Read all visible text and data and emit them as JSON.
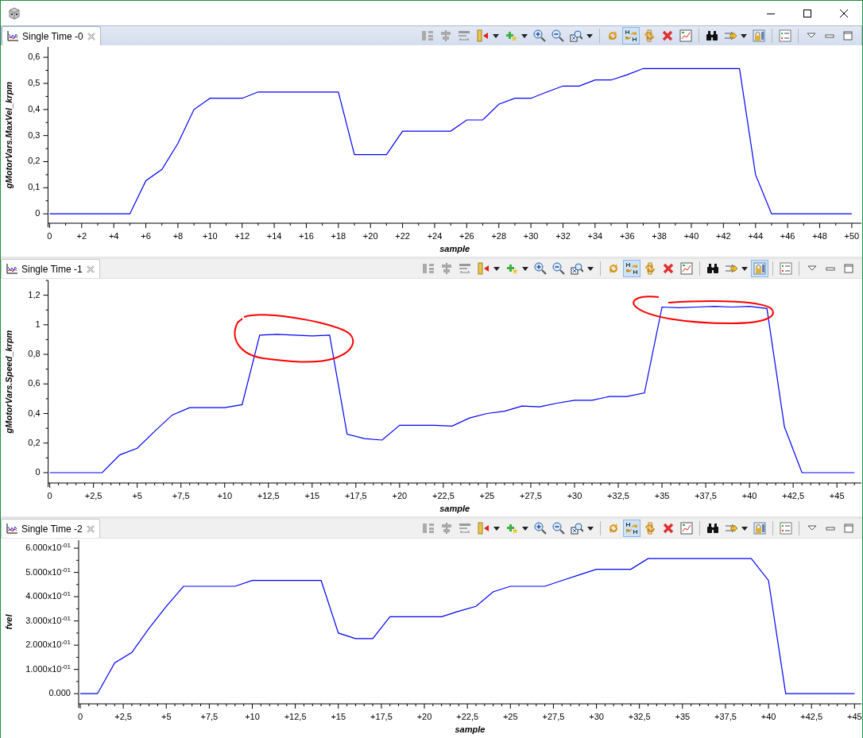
{
  "panels": [
    {
      "tab": {
        "label": "Single Time -0",
        "active": true
      },
      "toolbar": [
        {
          "selected": false
        },
        {
          "selected": false
        },
        {
          "selected": false
        },
        {
          "selected": false
        },
        {
          "selected": false
        },
        {
          "selected": false
        },
        {
          "selected": false
        },
        {
          "selected": false
        },
        {
          "selected": false
        },
        {
          "selected": true
        },
        {
          "selected": false
        },
        {
          "selected": false
        },
        {
          "selected": false
        },
        {
          "selected": false
        },
        {
          "selected": false
        },
        {
          "selected": false
        },
        {
          "selected": false
        }
      ],
      "chart_data": {
        "type": "line",
        "xlabel": "sample",
        "ylabel": "gMotorVars.MaxVel_krpm",
        "xlim": [
          -0.1,
          50.6
        ],
        "ylim": [
          -0.036,
          0.64
        ],
        "x": [
          0,
          1,
          2,
          3,
          4,
          5,
          6,
          7,
          8,
          9,
          10,
          11,
          12,
          13,
          14,
          15,
          16,
          17,
          18,
          19,
          20,
          21,
          22,
          23,
          24,
          25,
          26,
          27,
          28,
          29,
          30,
          31,
          32,
          33,
          34,
          35,
          36,
          37,
          38,
          39,
          40,
          41,
          42,
          43,
          44,
          45,
          46,
          47,
          48,
          49,
          50
        ],
        "series": [
          {
            "color": "#0000ff",
            "values": [
              0,
              0,
              0,
              0,
              0,
              0,
              0.127,
              0.17,
              0.27,
              0.4,
              0.443,
              0.443,
              0.443,
              0.467,
              0.467,
              0.467,
              0.467,
              0.467,
              0.467,
              0.227,
              0.227,
              0.227,
              0.317,
              0.317,
              0.317,
              0.317,
              0.36,
              0.36,
              0.42,
              0.443,
              0.443,
              0.467,
              0.49,
              0.49,
              0.513,
              0.513,
              0.533,
              0.557,
              0.557,
              0.557,
              0.557,
              0.557,
              0.557,
              0.557,
              0.15,
              0,
              0,
              0,
              0,
              0,
              0
            ]
          }
        ],
        "xticks": [
          {
            "value": 0,
            "label": "0"
          },
          {
            "value": 2,
            "label": "+2"
          },
          {
            "value": 4,
            "label": "+4"
          },
          {
            "value": 6,
            "label": "+6"
          },
          {
            "value": 8,
            "label": "+8"
          },
          {
            "value": 10,
            "label": "+10"
          },
          {
            "value": 12,
            "label": "+12"
          },
          {
            "value": 14,
            "label": "+14"
          },
          {
            "value": 16,
            "label": "+16"
          },
          {
            "value": 18,
            "label": "+18"
          },
          {
            "value": 20,
            "label": "+20"
          },
          {
            "value": 22,
            "label": "+22"
          },
          {
            "value": 24,
            "label": "+24"
          },
          {
            "value": 26,
            "label": "+26"
          },
          {
            "value": 28,
            "label": "+28"
          },
          {
            "value": 30,
            "label": "+30"
          },
          {
            "value": 32,
            "label": "+32"
          },
          {
            "value": 34,
            "label": "+34"
          },
          {
            "value": 36,
            "label": "+36"
          },
          {
            "value": 38,
            "label": "+38"
          },
          {
            "value": 40,
            "label": "+40"
          },
          {
            "value": 42,
            "label": "+42"
          },
          {
            "value": 44,
            "label": "+44"
          },
          {
            "value": 46,
            "label": "+46"
          },
          {
            "value": 48,
            "label": "+48"
          },
          {
            "value": 50,
            "label": "+50"
          }
        ],
        "yticks": [
          {
            "value": 0,
            "label": "0"
          },
          {
            "value": 0.1,
            "label": "0,1"
          },
          {
            "value": 0.2,
            "label": "0,2"
          },
          {
            "value": 0.3,
            "label": "0,3"
          },
          {
            "value": 0.4,
            "label": "0,4"
          },
          {
            "value": 0.5,
            "label": "0,5"
          },
          {
            "value": 0.6,
            "label": "0,6"
          }
        ]
      }
    },
    {
      "tab": {
        "label": "Single Time -1",
        "active": false
      },
      "red_marks": true,
      "toolbar": [
        {
          "selected": false
        },
        {
          "selected": false
        },
        {
          "selected": false
        },
        {
          "selected": false
        },
        {
          "selected": false
        },
        {
          "selected": false
        },
        {
          "selected": false
        },
        {
          "selected": false
        },
        {
          "selected": false
        },
        {
          "selected": true
        },
        {
          "selected": false
        },
        {
          "selected": false
        },
        {
          "selected": false
        },
        {
          "selected": false
        },
        {
          "selected": false
        },
        {
          "selected": true
        },
        {
          "selected": false
        }
      ],
      "chart_data": {
        "type": "line",
        "xlabel": "sample",
        "ylabel": "gMotorVars.Speed_krpm",
        "xlim": [
          -0.1,
          46.4
        ],
        "ylim": [
          -0.07,
          1.3
        ],
        "x": [
          0,
          1,
          2,
          3,
          4,
          5,
          6,
          7,
          8,
          9,
          10,
          11,
          12,
          13,
          14,
          15,
          16,
          17,
          18,
          19,
          20,
          21,
          22,
          23,
          24,
          25,
          26,
          27,
          28,
          29,
          30,
          31,
          32,
          33,
          34,
          35,
          36,
          37,
          38,
          39,
          40,
          41,
          42,
          43,
          44,
          45,
          46
        ],
        "series": [
          {
            "color": "#0000ff",
            "values": [
              0,
              0,
              0,
              0,
              0.12,
              0.165,
              0.28,
              0.39,
              0.44,
              0.44,
              0.44,
              0.46,
              0.93,
              0.935,
              0.93,
              0.925,
              0.93,
              0.26,
              0.23,
              0.22,
              0.32,
              0.32,
              0.32,
              0.315,
              0.37,
              0.4,
              0.415,
              0.45,
              0.445,
              0.47,
              0.49,
              0.49,
              0.515,
              0.515,
              0.54,
              1.12,
              1.115,
              1.12,
              1.125,
              1.12,
              1.125,
              1.11,
              0.31,
              0,
              0,
              0,
              0
            ]
          }
        ],
        "xticks": [
          {
            "value": 0,
            "label": "0"
          },
          {
            "value": 2.5,
            "label": "+2,5"
          },
          {
            "value": 5,
            "label": "+5"
          },
          {
            "value": 7.5,
            "label": "+7,5"
          },
          {
            "value": 10,
            "label": "+10"
          },
          {
            "value": 12.5,
            "label": "+12,5"
          },
          {
            "value": 15,
            "label": "+15"
          },
          {
            "value": 17.5,
            "label": "+17,5"
          },
          {
            "value": 20,
            "label": "+20"
          },
          {
            "value": 22.5,
            "label": "+22,5"
          },
          {
            "value": 25,
            "label": "+25"
          },
          {
            "value": 27.5,
            "label": "+27,5"
          },
          {
            "value": 30,
            "label": "+30"
          },
          {
            "value": 32.5,
            "label": "+32,5"
          },
          {
            "value": 35,
            "label": "+35"
          },
          {
            "value": 37.5,
            "label": "+37,5"
          },
          {
            "value": 40,
            "label": "+40"
          },
          {
            "value": 42.5,
            "label": "+42,5"
          },
          {
            "value": 45,
            "label": "+45"
          }
        ],
        "yticks": [
          {
            "value": 0,
            "label": "0"
          },
          {
            "value": 0.2,
            "label": "0,2"
          },
          {
            "value": 0.4,
            "label": "0,4"
          },
          {
            "value": 0.6,
            "label": "0,6"
          },
          {
            "value": 0.8,
            "label": "0,8"
          },
          {
            "value": 1,
            "label": "1"
          },
          {
            "value": 1.2,
            "label": "1,2"
          }
        ]
      }
    },
    {
      "tab": {
        "label": "Single Time -2",
        "active": false
      },
      "toolbar": [
        {
          "selected": false
        },
        {
          "selected": false
        },
        {
          "selected": false
        },
        {
          "selected": false
        },
        {
          "selected": false
        },
        {
          "selected": false
        },
        {
          "selected": false
        },
        {
          "selected": false
        },
        {
          "selected": false
        },
        {
          "selected": true
        },
        {
          "selected": false
        },
        {
          "selected": false
        },
        {
          "selected": false
        },
        {
          "selected": false
        },
        {
          "selected": false
        },
        {
          "selected": false
        },
        {
          "selected": false
        }
      ],
      "chart_data": {
        "type": "line",
        "xlabel": "sample",
        "ylabel": "fvel",
        "xlim": [
          -0.1,
          45.4
        ],
        "ylim": [
          -0.042,
          0.633
        ],
        "x": [
          0,
          1,
          2,
          3,
          4,
          5,
          6,
          7,
          8,
          9,
          10,
          11,
          12,
          13,
          14,
          15,
          16,
          17,
          18,
          19,
          20,
          21,
          22,
          23,
          24,
          25,
          26,
          27,
          28,
          29,
          30,
          31,
          32,
          33,
          34,
          35,
          36,
          37,
          38,
          39,
          40,
          41,
          42,
          43,
          44,
          45
        ],
        "series": [
          {
            "color": "#0000ff",
            "values": [
              0,
              0,
              0.127,
              0.17,
              0.27,
              0.36,
              0.443,
              0.443,
              0.443,
              0.443,
              0.467,
              0.467,
              0.467,
              0.467,
              0.467,
              0.25,
              0.227,
              0.227,
              0.317,
              0.317,
              0.317,
              0.317,
              0.34,
              0.36,
              0.42,
              0.443,
              0.443,
              0.443,
              0.467,
              0.49,
              0.513,
              0.513,
              0.513,
              0.557,
              0.557,
              0.557,
              0.557,
              0.557,
              0.557,
              0.557,
              0.467,
              0,
              0,
              0,
              0,
              0
            ]
          }
        ],
        "xticks": [
          {
            "value": 0,
            "label": "0"
          },
          {
            "value": 2.5,
            "label": "+2,5"
          },
          {
            "value": 5,
            "label": "+5"
          },
          {
            "value": 7.5,
            "label": "+7,5"
          },
          {
            "value": 10,
            "label": "+10"
          },
          {
            "value": 12.5,
            "label": "+12,5"
          },
          {
            "value": 15,
            "label": "+15"
          },
          {
            "value": 17.5,
            "label": "+17,5"
          },
          {
            "value": 20,
            "label": "+20"
          },
          {
            "value": 22.5,
            "label": "+22,5"
          },
          {
            "value": 25,
            "label": "+25"
          },
          {
            "value": 27.5,
            "label": "+27,5"
          },
          {
            "value": 30,
            "label": "+30"
          },
          {
            "value": 32.5,
            "label": "+32,5"
          },
          {
            "value": 35,
            "label": "+35"
          },
          {
            "value": 37.5,
            "label": "+37,5"
          },
          {
            "value": 40,
            "label": "+40"
          },
          {
            "value": 42.5,
            "label": "+42,5"
          },
          {
            "value": 45,
            "label": "+45"
          }
        ],
        "yticks": [
          {
            "value": 0,
            "label": "0.000"
          },
          {
            "value": 0.1,
            "label": "1.000x10$^{-01}$"
          },
          {
            "value": 0.2,
            "label": "2.000x10$^{-01}$"
          },
          {
            "value": 0.3,
            "label": "3.000x10$^{-01}$"
          },
          {
            "value": 0.4,
            "label": "4.000x10$^{-01}$"
          },
          {
            "value": 0.5,
            "label": "5.000x10$^{-01}$"
          },
          {
            "value": 0.6,
            "label": "6.000x10$^{-01}$"
          }
        ]
      }
    }
  ]
}
